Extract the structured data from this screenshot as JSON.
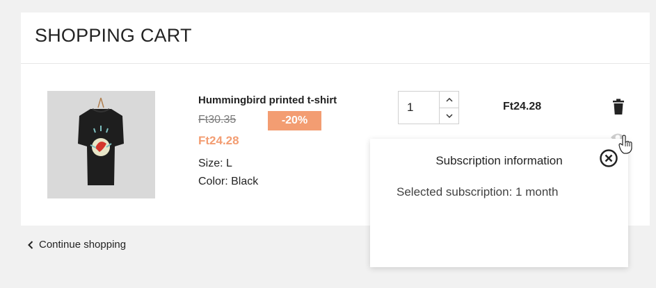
{
  "cart": {
    "title": "SHOPPING CART",
    "continue_label": "Continue shopping"
  },
  "product": {
    "name": "Hummingbird printed t-shirt",
    "old_price": "Ft30.35",
    "discount": "-20%",
    "price": "Ft24.28",
    "size": "Size: L",
    "color": "Color: Black",
    "quantity": "1",
    "line_total": "Ft24.28",
    "image_icon": "tshirt-image"
  },
  "popup": {
    "title": "Subscription information",
    "body": "Selected subscription: 1 month"
  },
  "colors": {
    "accent": "#f39d72",
    "background": "#f1f1f1",
    "card": "#ffffff"
  }
}
